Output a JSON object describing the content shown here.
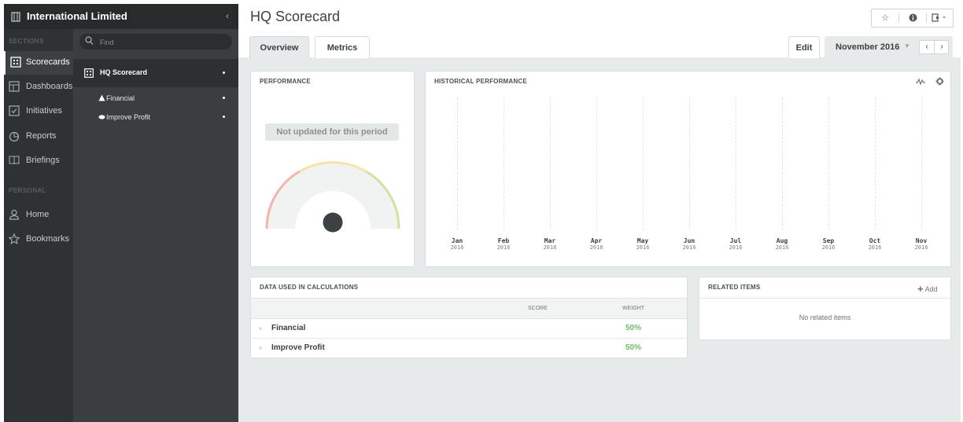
{
  "org": {
    "name": "International Limited",
    "collapse_icon": "chevron-left-icon"
  },
  "nav": {
    "sections_label": "SECTIONS",
    "personal_label": "PERSONAL",
    "items": [
      {
        "label": "Scorecards",
        "icon": "scorecard-icon",
        "active": true
      },
      {
        "label": "Dashboards",
        "icon": "dashboard-icon"
      },
      {
        "label": "Initiatives",
        "icon": "checkbox-icon"
      },
      {
        "label": "Reports",
        "icon": "pie-chart-icon"
      },
      {
        "label": "Briefings",
        "icon": "book-icon"
      },
      {
        "label": "Home",
        "icon": "user-icon"
      },
      {
        "label": "Bookmarks",
        "icon": "star-icon"
      }
    ]
  },
  "search": {
    "placeholder": "Find"
  },
  "tree": {
    "root": "HQ Scorecard",
    "items": [
      {
        "label": "Financial",
        "icon": "triangle-icon"
      },
      {
        "label": "Improve Profit",
        "icon": "ellipse-icon"
      }
    ]
  },
  "page": {
    "title": "HQ Scorecard"
  },
  "tabs": {
    "overview": "Overview",
    "metrics": "Metrics",
    "edit": "Edit"
  },
  "period": {
    "month": "November 2016"
  },
  "performance": {
    "title": "PERFORMANCE",
    "status": "Not updated for this period"
  },
  "history": {
    "title": "HISTORICAL PERFORMANCE"
  },
  "chart_data": {
    "type": "line",
    "title": "HISTORICAL PERFORMANCE",
    "categories": [
      "Jan",
      "Feb",
      "Mar",
      "Apr",
      "May",
      "Jun",
      "Jul",
      "Aug",
      "Sep",
      "Oct",
      "Nov"
    ],
    "year": "2016",
    "series": [],
    "grid": true
  },
  "calc": {
    "title": "DATA USED IN CALCULATIONS",
    "col_score": "SCORE",
    "col_weight": "WEIGHT",
    "rows": [
      {
        "name": "Financial",
        "weight": "50%"
      },
      {
        "name": "Improve Profit",
        "weight": "50%"
      }
    ]
  },
  "related": {
    "title": "RELATED ITEMS",
    "add": "Add",
    "empty": "No related items"
  }
}
